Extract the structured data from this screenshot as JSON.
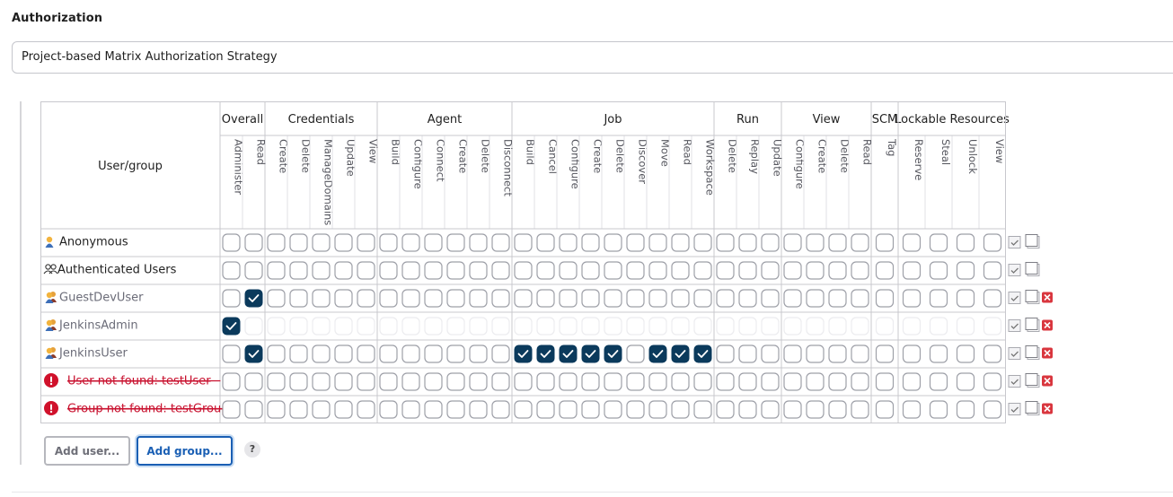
{
  "section_title": "Authorization",
  "strategy": {
    "selected": "Project-based Matrix Authorization Strategy"
  },
  "user_group_header": "User/group",
  "groups": [
    {
      "name": "Overall",
      "permissions": [
        "Administer",
        "Read"
      ]
    },
    {
      "name": "Credentials",
      "permissions": [
        "Create",
        "Delete",
        "ManageDomains",
        "Update",
        "View"
      ]
    },
    {
      "name": "Agent",
      "permissions": [
        "Build",
        "Configure",
        "Connect",
        "Create",
        "Delete",
        "Disconnect"
      ]
    },
    {
      "name": "Job",
      "permissions": [
        "Build",
        "Cancel",
        "Configure",
        "Create",
        "Delete",
        "Discover",
        "Move",
        "Read",
        "Workspace"
      ]
    },
    {
      "name": "Run",
      "permissions": [
        "Delete",
        "Replay",
        "Update"
      ]
    },
    {
      "name": "View",
      "permissions": [
        "Configure",
        "Create",
        "Delete",
        "Read"
      ]
    },
    {
      "name": "SCM",
      "permissions": [
        "Tag"
      ]
    },
    {
      "name": "Lockable Resources",
      "permissions": [
        "Reserve",
        "Steal",
        "Unlock",
        "View"
      ]
    }
  ],
  "rows": [
    {
      "name": "Anonymous",
      "icon": "user-icon",
      "style": "builtin",
      "checked": [],
      "disabled_all_but_admin": false,
      "removable": false
    },
    {
      "name": "Authenticated Users",
      "icon": "users-group-icon",
      "style": "builtin",
      "checked": [],
      "disabled_all_but_admin": false,
      "removable": false
    },
    {
      "name": "GuestDevUser",
      "icon": "user-pair-icon",
      "style": "user",
      "checked": [
        1
      ],
      "disabled_all_but_admin": false,
      "removable": true
    },
    {
      "name": "JenkinsAdmin",
      "icon": "user-pair-icon",
      "style": "user",
      "checked": [
        0
      ],
      "disabled_all_but_admin": true,
      "removable": true
    },
    {
      "name": "JenkinsUser",
      "icon": "user-pair-icon",
      "style": "user",
      "checked": [
        1,
        13,
        14,
        15,
        16,
        17,
        19,
        20,
        21
      ],
      "disabled_all_but_admin": false,
      "removable": true
    },
    {
      "name": "User not found: testUser",
      "icon": "error-icon",
      "style": "missing",
      "checked": [],
      "disabled_all_but_admin": false,
      "removable": true
    },
    {
      "name": "Group not found: testGroup",
      "icon": "error-icon",
      "style": "missing",
      "checked": [],
      "disabled_all_but_admin": false,
      "removable": true
    }
  ],
  "buttons": {
    "add_user": "Add user...",
    "add_group": "Add group...",
    "help": "?"
  },
  "colors": {
    "checked_fill": "#0b3a5c",
    "missing_text": "#c8102e",
    "user_text": "#6b6c78",
    "remove_red": "#d9363e"
  }
}
